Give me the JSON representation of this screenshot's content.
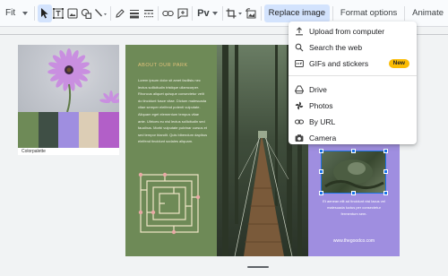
{
  "toolbar": {
    "zoom_value": "Fit",
    "font_label": "Pv",
    "replace_image_label": "Replace image",
    "format_options_label": "Format options",
    "animate_label": "Animate"
  },
  "replace_image_menu": {
    "upload": "Upload from computer",
    "search_web": "Search the web",
    "gifs_stickers": "GIFs and stickers",
    "gifs_badge": "New",
    "drive": "Drive",
    "photos": "Photos",
    "by_url": "By URL",
    "camera": "Camera"
  },
  "slide": {
    "palette_label": "Colorpalette",
    "palette_colors": [
      "#6e8a57",
      "#3f4f45",
      "#9f8ee0",
      "#dccdb5",
      "#b25fc8"
    ],
    "green_panel_title": "ABOUT OUR PARK",
    "green_panel_body": "Lorem ipsum dolor sit amet facilisis nec lectus sollicitudin tristique ullamcorper. Rhoncus aliquet quisque consectetur velit do tincidunt fusce vitae. Dictum malesuada vitae semper eleifend potenti vulputate. Aliquam eget elementum tempus vitae ante. Ultrices eu nisl lectus sollicitudin sed faucibus. Morbi vulputate pulvinar cursus et sed tempor blandit. Quis bibendum dapibus eleifend tincidunt sodales aliquam.",
    "purple_panel_body": "Et aenean elit ad tincidunt nisi lacus vel malesuada luctus per consectetur fermentum sem.",
    "website_url": "www.thegoodco.com"
  },
  "colors": {
    "selection_blue": "#1a73e8",
    "active_button": "#d3e3fd",
    "new_badge": "#fbbc04"
  }
}
